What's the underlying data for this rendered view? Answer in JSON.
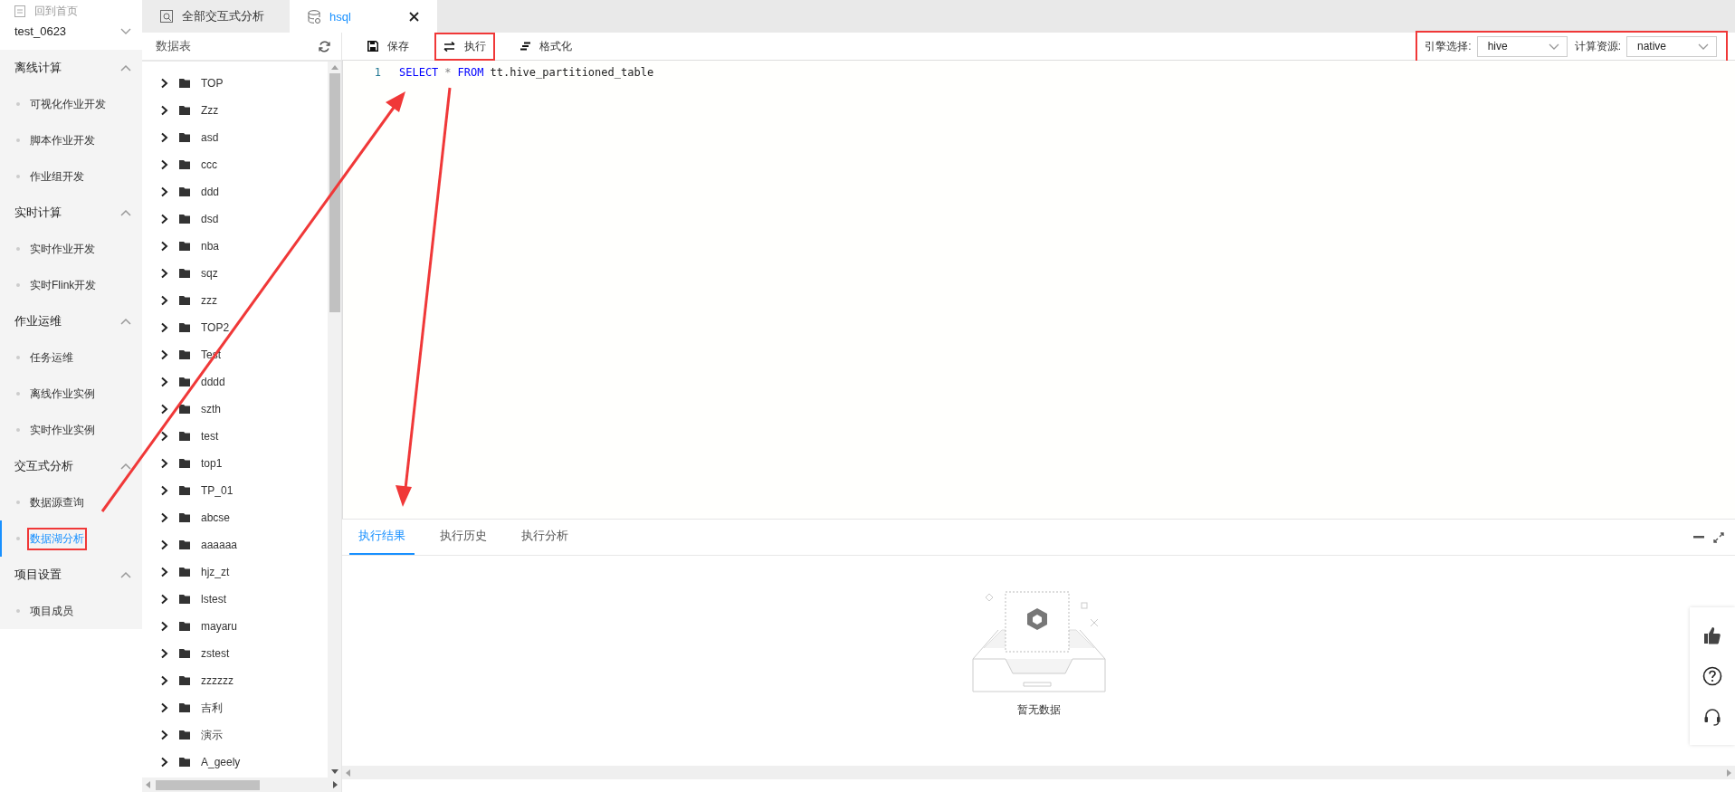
{
  "sidebar": {
    "home_link": "回到首页",
    "project": "test_0623",
    "sections": [
      {
        "title": "离线计算",
        "expanded": true,
        "items": [
          {
            "label": "可视化作业开发",
            "selected": false,
            "highlighted": false
          },
          {
            "label": "脚本作业开发",
            "selected": false,
            "highlighted": false
          },
          {
            "label": "作业组开发",
            "selected": false,
            "highlighted": false
          }
        ]
      },
      {
        "title": "实时计算",
        "expanded": true,
        "items": [
          {
            "label": "实时作业开发",
            "selected": false,
            "highlighted": false
          },
          {
            "label": "实时Flink开发",
            "selected": false,
            "highlighted": false
          }
        ]
      },
      {
        "title": "作业运维",
        "expanded": true,
        "items": [
          {
            "label": "任务运维",
            "selected": false,
            "highlighted": false
          },
          {
            "label": "离线作业实例",
            "selected": false,
            "highlighted": false
          },
          {
            "label": "实时作业实例",
            "selected": false,
            "highlighted": false
          }
        ]
      },
      {
        "title": "交互式分析",
        "expanded": true,
        "items": [
          {
            "label": "数据源查询",
            "selected": false,
            "highlighted": false
          },
          {
            "label": "数据湖分析",
            "selected": true,
            "highlighted": true
          }
        ]
      },
      {
        "title": "项目设置",
        "expanded": true,
        "items": [
          {
            "label": "项目成员",
            "selected": false,
            "highlighted": false
          }
        ]
      }
    ]
  },
  "tabs": [
    {
      "label": "全部交互式分析",
      "kind": "overview",
      "selected": false,
      "closable": false
    },
    {
      "label": "hsql",
      "kind": "query",
      "selected": true,
      "closable": true
    }
  ],
  "table_panel": {
    "title": "数据表",
    "tables": [
      {
        "name": "TOP",
        "expanded": false
      },
      {
        "name": "Zzz",
        "expanded": false
      },
      {
        "name": "asd",
        "expanded": false
      },
      {
        "name": "ccc",
        "expanded": false
      },
      {
        "name": "ddd",
        "expanded": false
      },
      {
        "name": "dsd",
        "expanded": false
      },
      {
        "name": "nba",
        "expanded": false
      },
      {
        "name": "sqz",
        "expanded": false
      },
      {
        "name": "zzz",
        "expanded": false
      },
      {
        "name": "TOP2",
        "expanded": false
      },
      {
        "name": "Test",
        "expanded": false
      },
      {
        "name": "dddd",
        "expanded": false
      },
      {
        "name": "szth",
        "expanded": false
      },
      {
        "name": "test",
        "expanded": false
      },
      {
        "name": "top1",
        "expanded": false
      },
      {
        "name": "TP_01",
        "expanded": false
      },
      {
        "name": "abcse",
        "expanded": false
      },
      {
        "name": "aaaaaa",
        "expanded": false
      },
      {
        "name": "hjz_zt",
        "expanded": false
      },
      {
        "name": "lstest",
        "expanded": false
      },
      {
        "name": "mayaru",
        "expanded": false
      },
      {
        "name": "zstest",
        "expanded": false
      },
      {
        "name": "zzzzzz",
        "expanded": false
      },
      {
        "name": "吉利",
        "expanded": false
      },
      {
        "name": "演示",
        "expanded": false
      },
      {
        "name": "A_geely",
        "expanded": false
      }
    ]
  },
  "toolbar": {
    "actions": [
      {
        "label": "保存",
        "kind": "save",
        "highlighted": false
      },
      {
        "label": "执行",
        "kind": "run",
        "highlighted": true
      },
      {
        "label": "格式化",
        "kind": "format",
        "highlighted": false
      }
    ],
    "highlighted": true,
    "engine_label": "引擎选择:",
    "engine": "hive",
    "resource_label": "计算资源:",
    "resource": "native"
  },
  "editor": {
    "lines": [
      {
        "number": "1",
        "tokens": [
          {
            "text": "SELECT",
            "kind": "keyword"
          },
          {
            "text": "*",
            "kind": "operator"
          },
          {
            "text": "FROM",
            "kind": "keyword"
          },
          {
            "text": "tt.hive_partitioned_table",
            "kind": "plain"
          }
        ]
      }
    ]
  },
  "results": {
    "tabs": [
      {
        "label": "执行结果",
        "selected": true
      },
      {
        "label": "执行历史",
        "selected": false
      },
      {
        "label": "执行分析",
        "selected": false
      }
    ],
    "empty_text": "暂无数据"
  }
}
